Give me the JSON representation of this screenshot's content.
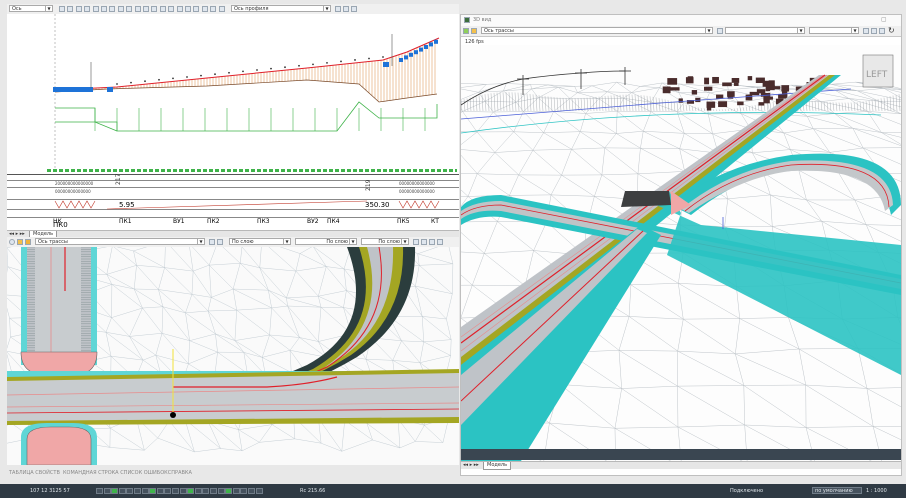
{
  "top_toolbar": {
    "layer_combo": "Ось",
    "profile_combo": "Ось профиля"
  },
  "profile_view": {
    "values": {
      "left_value": "5.95",
      "right_value": "350.30",
      "label_217": "217",
      "label_219": "219"
    },
    "stations": [
      "НК",
      "ПК1",
      "ВУ1",
      "ПК2",
      "ПК3",
      "ВУ2",
      "ПК4",
      "ПК5",
      "КТ"
    ],
    "left_station": "ПК0",
    "tab_label": "Модель"
  },
  "plan_toolbar": {
    "axis_combo": "Ось трассы",
    "layer_combo": "По слою",
    "linetype_combo": "По слою",
    "lineweight_combo": "По слою"
  },
  "view3d": {
    "title": "3D вид",
    "axis_combo": "Ось трассы",
    "fps": "126 fps",
    "tab_label": "Модель",
    "sign_text": "LEFT"
  },
  "bottom_tabs": [
    "ТАБЛИЦА СВОЙСТВ",
    "КОМАНДНАЯ СТРОКА",
    "СПИСОК ОШИБОК",
    "СПРАВКА"
  ],
  "status_bar": {
    "coords": "107 12 3125 57",
    "mid_value": "Rc 215.66",
    "state": "Подключено",
    "scale": "1 : 1000"
  },
  "colors": {
    "accent_blue": "#1e73d8",
    "design_red": "#e0202a",
    "ground_orange": "#d9863a",
    "green": "#3fb34a",
    "teal": "#2bc3c3",
    "olive": "#a4a623"
  }
}
